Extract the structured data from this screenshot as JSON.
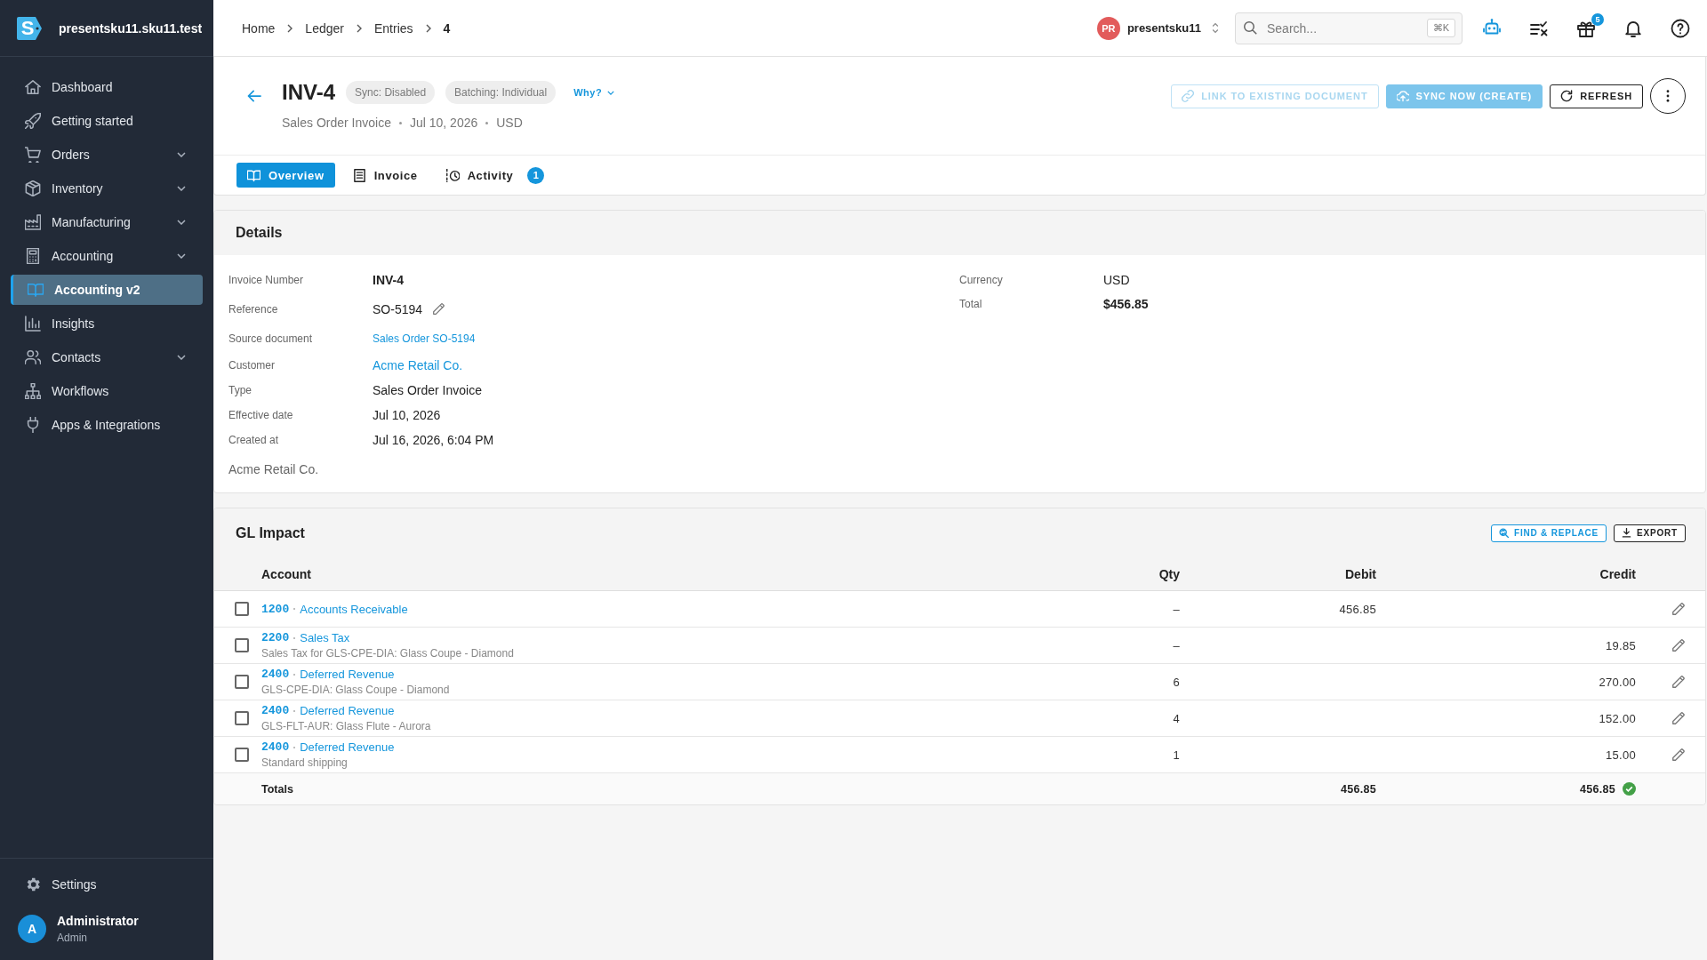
{
  "sidebar": {
    "logo_letter": "S",
    "workspace": "presentsku11.sku11.test",
    "items": [
      {
        "label": "Dashboard",
        "expandable": false,
        "selected": false
      },
      {
        "label": "Getting started",
        "expandable": false,
        "selected": false
      },
      {
        "label": "Orders",
        "expandable": true,
        "selected": false
      },
      {
        "label": "Inventory",
        "expandable": true,
        "selected": false
      },
      {
        "label": "Manufacturing",
        "expandable": true,
        "selected": false
      },
      {
        "label": "Accounting",
        "expandable": true,
        "selected": false
      },
      {
        "label": "Accounting v2",
        "expandable": false,
        "selected": true
      },
      {
        "label": "Insights",
        "expandable": false,
        "selected": false
      },
      {
        "label": "Contacts",
        "expandable": true,
        "selected": false
      },
      {
        "label": "Workflows",
        "expandable": false,
        "selected": false
      },
      {
        "label": "Apps & Integrations",
        "expandable": false,
        "selected": false
      }
    ],
    "settings": {
      "label": "Settings"
    },
    "user": {
      "initial": "A",
      "name": "Administrator",
      "role": "Admin"
    }
  },
  "topbar": {
    "breadcrumbs": [
      "Home",
      "Ledger",
      "Entries",
      "4"
    ],
    "account": {
      "initials": "PR",
      "name": "presentsku11"
    },
    "search": {
      "placeholder": "Search...",
      "shortcut": "⌘K"
    },
    "gift_badge": "5"
  },
  "header": {
    "title": "INV-4",
    "chips": [
      "Sync: Disabled",
      "Batching: Individual"
    ],
    "why": "Why?",
    "meta": [
      "Sales Order Invoice",
      "Jul 10, 2026",
      "USD"
    ],
    "actions": [
      {
        "kind": "link",
        "label": "LINK TO EXISTING DOCUMENT",
        "disabled": true
      },
      {
        "kind": "sync",
        "label": "SYNC NOW (CREATE)",
        "disabled": true
      },
      {
        "kind": "refresh",
        "label": "REFRESH",
        "disabled": false
      }
    ],
    "tabs": [
      {
        "label": "Overview",
        "selected": true
      },
      {
        "label": "Invoice",
        "selected": false
      },
      {
        "label": "Activity",
        "selected": false,
        "badge": "1"
      }
    ]
  },
  "details": {
    "title": "Details",
    "left": [
      {
        "label": "Invoice Number",
        "value": "INV-4",
        "kind": "strong"
      },
      {
        "label": "Reference",
        "value": "SO-5194",
        "kind": "editable"
      },
      {
        "label": "Source document",
        "value": "Sales Order SO-5194",
        "kind": "sublink"
      },
      {
        "label": "Customer",
        "value": "Acme Retail Co.",
        "kind": "link"
      },
      {
        "label": "Type",
        "value": "Sales Order Invoice",
        "kind": "text"
      },
      {
        "label": "Effective date",
        "value": "Jul 10, 2026",
        "kind": "text"
      },
      {
        "label": "Created at",
        "value": "Jul 16, 2026, 6:04 PM",
        "kind": "text"
      }
    ],
    "right": [
      {
        "label": "Currency",
        "value": "USD",
        "kind": "text"
      },
      {
        "label": "Total",
        "value": "$456.85",
        "kind": "strong"
      }
    ],
    "note": "Acme Retail Co."
  },
  "gl_impact": {
    "title": "GL Impact",
    "actions": [
      {
        "kind": "find",
        "label": "FIND & REPLACE"
      },
      {
        "kind": "export",
        "label": "EXPORT"
      }
    ],
    "columns": [
      "Account",
      "Qty",
      "Debit",
      "Credit"
    ],
    "rows": [
      {
        "checked": false,
        "code": "1200",
        "account": "Accounts Receivable",
        "qty": "–",
        "debit": "456.85"
      },
      {
        "checked": false,
        "code": "2200",
        "account": "Sales Tax",
        "memo": "Sales Tax for GLS-CPE-DIA: Glass Coupe - Diamond",
        "qty": "–",
        "credit": "19.85"
      },
      {
        "checked": false,
        "code": "2400",
        "account": "Deferred Revenue",
        "memo": "GLS-CPE-DIA: Glass Coupe - Diamond",
        "qty": "6",
        "credit": "270.00"
      },
      {
        "checked": false,
        "code": "2400",
        "account": "Deferred Revenue",
        "memo": "GLS-FLT-AUR: Glass Flute - Aurora",
        "qty": "4",
        "credit": "152.00"
      },
      {
        "checked": false,
        "code": "2400",
        "account": "Deferred Revenue",
        "memo": "Standard shipping",
        "qty": "1",
        "credit": "15.00"
      }
    ],
    "totals": {
      "label": "Totals",
      "debit": "456.85",
      "credit": "456.85",
      "balanced": true
    }
  }
}
